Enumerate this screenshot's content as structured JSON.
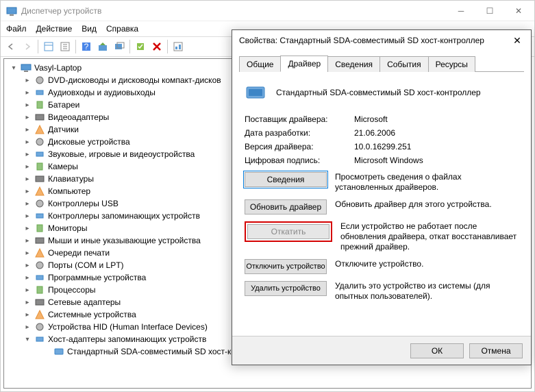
{
  "window": {
    "title": "Диспетчер устройств"
  },
  "menu": {
    "file": "Файл",
    "action": "Действие",
    "view": "Вид",
    "help": "Справка"
  },
  "tree": {
    "root": "Vasyl-Laptop",
    "items": [
      "DVD-дисководы и дисководы компакт-дисков",
      "Аудиовходы и аудиовыходы",
      "Батареи",
      "Видеоадаптеры",
      "Датчики",
      "Дисковые устройства",
      "Звуковые, игровые и видеоустройства",
      "Камеры",
      "Клавиатуры",
      "Компьютер",
      "Контроллеры USB",
      "Контроллеры запоминающих устройств",
      "Мониторы",
      "Мыши и иные указывающие устройства",
      "Очереди печати",
      "Порты (COM и LPT)",
      "Программные устройства",
      "Процессоры",
      "Сетевые адаптеры",
      "Системные устройства",
      "Устройства HID (Human Interface Devices)",
      "Хост-адаптеры запоминающих устройств"
    ],
    "child": "Стандартный SDA-совместимый SD хост-контроллер"
  },
  "dialog": {
    "title": "Свойства: Стандартный SDA-совместимый SD хост-контроллер",
    "tabs": {
      "general": "Общие",
      "driver": "Драйвер",
      "details": "Сведения",
      "events": "События",
      "resources": "Ресурсы"
    },
    "device_name": "Стандартный SDA-совместимый SD хост-контроллер",
    "props": {
      "provider_label": "Поставщик драйвера:",
      "provider_value": "Microsoft",
      "date_label": "Дата разработки:",
      "date_value": "21.06.2006",
      "version_label": "Версия драйвера:",
      "version_value": "10.0.16299.251",
      "sign_label": "Цифровая подпись:",
      "sign_value": "Microsoft Windows"
    },
    "buttons": {
      "details": "Сведения",
      "details_desc": "Просмотреть сведения о файлах установленных драйверов.",
      "update": "Обновить драйвер",
      "update_desc": "Обновить драйвер для этого устройства.",
      "rollback": "Откатить",
      "rollback_desc": "Если устройство не работает после обновления драйвера, откат восстанавливает прежний драйвер.",
      "disable": "Отключить устройство",
      "disable_desc": "Отключите устройство.",
      "uninstall": "Удалить устройство",
      "uninstall_desc": "Удалить это устройство из системы (для опытных пользователей)."
    },
    "footer": {
      "ok": "ОК",
      "cancel": "Отмена"
    }
  }
}
